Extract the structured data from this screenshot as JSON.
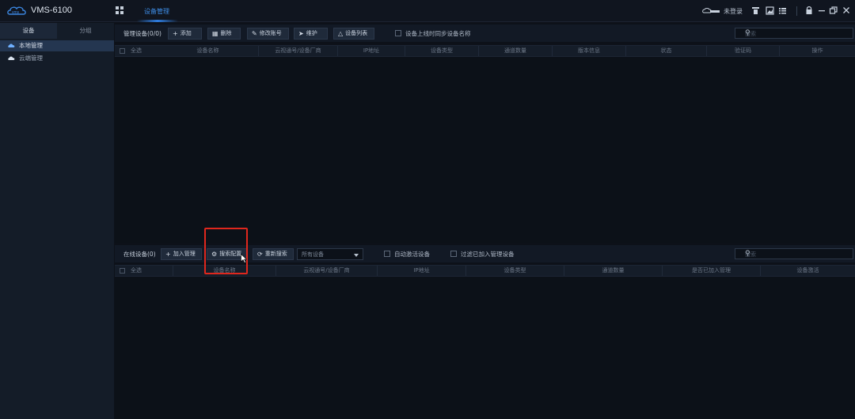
{
  "app": {
    "name": "VMS-6100",
    "top_tab": "设备管理",
    "login_status": "未登录"
  },
  "sidebar": {
    "tabs": [
      "设备",
      "分组"
    ],
    "items": [
      {
        "label": "本地管理",
        "icon": "local-device-icon",
        "selected": true
      },
      {
        "label": "云端管理",
        "icon": "cloud-icon",
        "selected": false
      }
    ]
  },
  "managed": {
    "title": "管理设备(0/0)",
    "buttons": {
      "add": "添加",
      "delete": "删除",
      "modify_account": "修改账号",
      "maintain": "维护",
      "device_list": "设备列表"
    },
    "sync_name_label": "设备上线时同步设备名称",
    "search_placeholder": "搜索",
    "columns": [
      "全选",
      "设备名称",
      "云视通号/设备厂商",
      "IP地址",
      "设备类型",
      "通道数量",
      "版本信息",
      "状态",
      "验证码",
      "操作"
    ]
  },
  "online": {
    "title": "在线设备(0)",
    "buttons": {
      "add_manage": "加入管理",
      "search_config": "搜索配置",
      "research": "重新搜索"
    },
    "filter_value": "所有设备",
    "auto_activate_label": "自动激活设备",
    "filter_added_label": "过滤已加入管理设备",
    "search_placeholder": "搜索",
    "columns": [
      "全选",
      "设备名称",
      "云视通号/设备厂商",
      "IP地址",
      "设备类型",
      "通道数量",
      "是否已加入管理",
      "设备激活"
    ]
  },
  "colors": {
    "accent": "#2e7de0",
    "highlight_box": "#e0271d"
  }
}
